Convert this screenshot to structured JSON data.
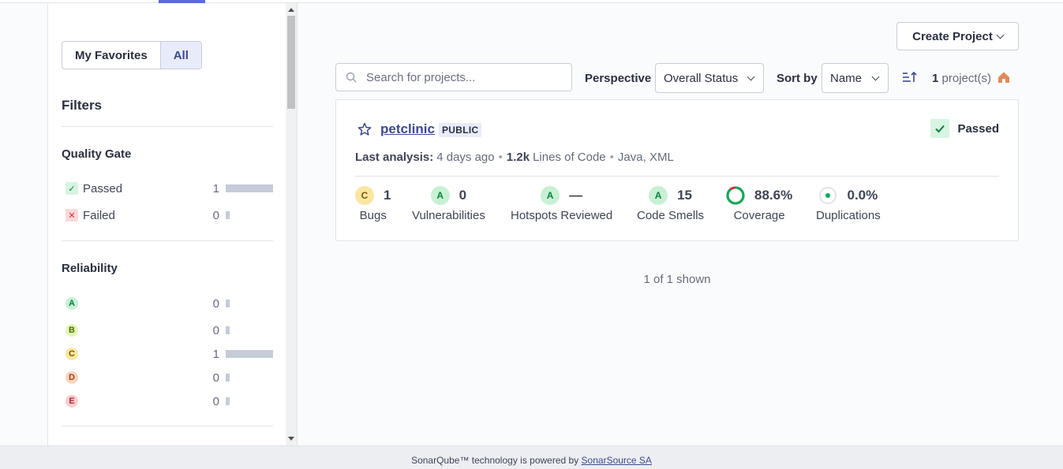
{
  "sidebar": {
    "favorites_toggle": {
      "my_favorites": "My Favorites",
      "all": "All"
    },
    "filters_title": "Filters",
    "quality_gate": {
      "title": "Quality Gate",
      "items": [
        {
          "label": "Passed",
          "count": "1",
          "fraction": 1.0
        },
        {
          "label": "Failed",
          "count": "0",
          "fraction": 0.0
        }
      ]
    },
    "reliability": {
      "title": "Reliability",
      "items": [
        {
          "rating": "A",
          "count": "0",
          "fraction": 0.0
        },
        {
          "rating": "B",
          "count": "0",
          "fraction": 0.0
        },
        {
          "rating": "C",
          "count": "1",
          "fraction": 1.0
        },
        {
          "rating": "D",
          "count": "0",
          "fraction": 0.0
        },
        {
          "rating": "E",
          "count": "0",
          "fraction": 0.0
        }
      ]
    }
  },
  "toolbar": {
    "create_project": "Create Project",
    "search_placeholder": "Search for projects...",
    "perspective_label": "Perspective",
    "perspective_value": "Overall Status",
    "sort_label": "Sort by",
    "sort_value": "Name",
    "project_count": "1",
    "project_count_suffix": "project(s)"
  },
  "project": {
    "name": "petclinic",
    "visibility": "PUBLIC",
    "quality_gate": "Passed",
    "last_analysis_label": "Last analysis:",
    "last_analysis_value": "4 days ago",
    "loc_value": "1.2k",
    "loc_label": "Lines of Code",
    "languages": "Java, XML",
    "measures": {
      "bugs": {
        "rating": "C",
        "value": "1",
        "label": "Bugs"
      },
      "vulnerabilities": {
        "rating": "A",
        "value": "0",
        "label": "Vulnerabilities"
      },
      "hotspots": {
        "rating": "A",
        "value": "—",
        "label": "Hotspots Reviewed"
      },
      "code_smells": {
        "rating": "A",
        "value": "15",
        "label": "Code Smells"
      },
      "coverage": {
        "value": "88.6%",
        "label": "Coverage",
        "fraction": 0.886
      },
      "duplications": {
        "value": "0.0%",
        "label": "Duplications"
      }
    }
  },
  "shown_text": "1 of 1 shown",
  "footer": {
    "prefix": "SonarQube™ technology is powered by",
    "link": "SonarSource SA"
  },
  "colors": {
    "accent": "#5d6cd0",
    "link": "#3b4a8e",
    "passed": "#0b7e40",
    "coverage_covered": "#00aa55",
    "coverage_uncovered": "#d02f3a",
    "home": "#e08a5c"
  }
}
